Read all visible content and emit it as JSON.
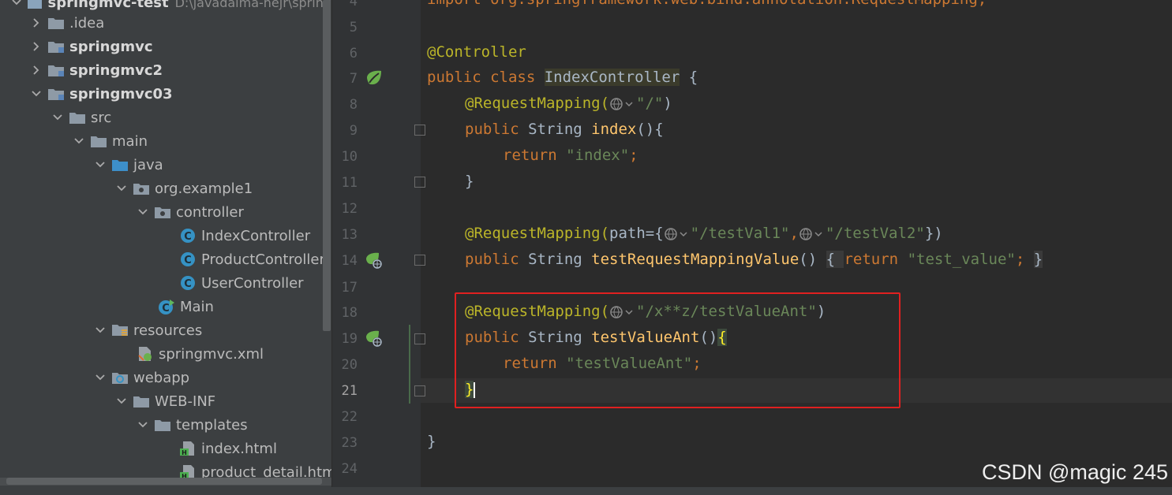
{
  "project_tree": {
    "root": {
      "name": "springmvc-test",
      "path": "D:\\javadaima-nejr\\spring"
    },
    "items": [
      {
        "label": ".idea",
        "bold": false
      },
      {
        "label": "springmvc",
        "bold": true
      },
      {
        "label": "springmvc2",
        "bold": true
      },
      {
        "label": "springmvc03",
        "bold": true
      },
      {
        "label": "src"
      },
      {
        "label": "main"
      },
      {
        "label": "java"
      },
      {
        "label": "org.example1"
      },
      {
        "label": "controller"
      },
      {
        "label": "IndexController"
      },
      {
        "label": "ProductController"
      },
      {
        "label": "UserController"
      },
      {
        "label": "Main"
      },
      {
        "label": "resources"
      },
      {
        "label": "springmvc.xml"
      },
      {
        "label": "webapp"
      },
      {
        "label": "WEB-INF"
      },
      {
        "label": "templates"
      },
      {
        "label": "index.html"
      },
      {
        "label": "product_detail.htm"
      }
    ]
  },
  "editor": {
    "line_numbers": [
      "4",
      "5",
      "6",
      "7",
      "8",
      "9",
      "10",
      "11",
      "12",
      "13",
      "14",
      "17",
      "18",
      "19",
      "20",
      "21",
      "22",
      "23",
      "24"
    ],
    "current_line": "21",
    "code": {
      "l4": "import org.springframework.web.bind.annotation.RequestMapping;",
      "l6_ann": "@Controller",
      "l7_kw": "public class ",
      "l7_cls": "IndexController",
      "l7_rest": " {",
      "l8_ann": "@RequestMapping(",
      "l8_str": "\"/\"",
      "l8_end": ")",
      "l9_kw": "public ",
      "l9_type": "String ",
      "l9_fn": "index",
      "l9_rest": "(){",
      "l10_kw": "return ",
      "l10_str": "\"index\"",
      "l10_end": ";",
      "l11": "}",
      "l13_ann": "@RequestMapping(",
      "l13_p1": "path={",
      "l13_s1": "\"/testVal1\"",
      "l13_comma": ",",
      "l13_s2": "\"/testVal2\"",
      "l13_end": "})",
      "l14_kw": "public ",
      "l14_type": "String ",
      "l14_fn": "testRequestMappingValue",
      "l14_paren": "() ",
      "l14_ob": "{ ",
      "l14_ret": "return ",
      "l14_str": "\"test_value\"",
      "l14_semi": "; ",
      "l14_cb": "}",
      "l18_ann": "@RequestMapping(",
      "l18_str": "\"/x**z/testValueAnt\"",
      "l18_end": ")",
      "l19_kw": "public ",
      "l19_type": "String ",
      "l19_fn": "testValueAnt",
      "l19_paren": "()",
      "l19_brace": "{",
      "l20_kw": "return ",
      "l20_str": "\"testValueAnt\"",
      "l20_end": ";",
      "l21": "}",
      "l23": "}"
    }
  },
  "watermark": "CSDN @magic 245",
  "colors": {
    "keyword": "#cc7832",
    "annotation": "#bbb529",
    "string": "#6a8759",
    "function": "#ffc66d",
    "highlight_box": "#e02020"
  }
}
